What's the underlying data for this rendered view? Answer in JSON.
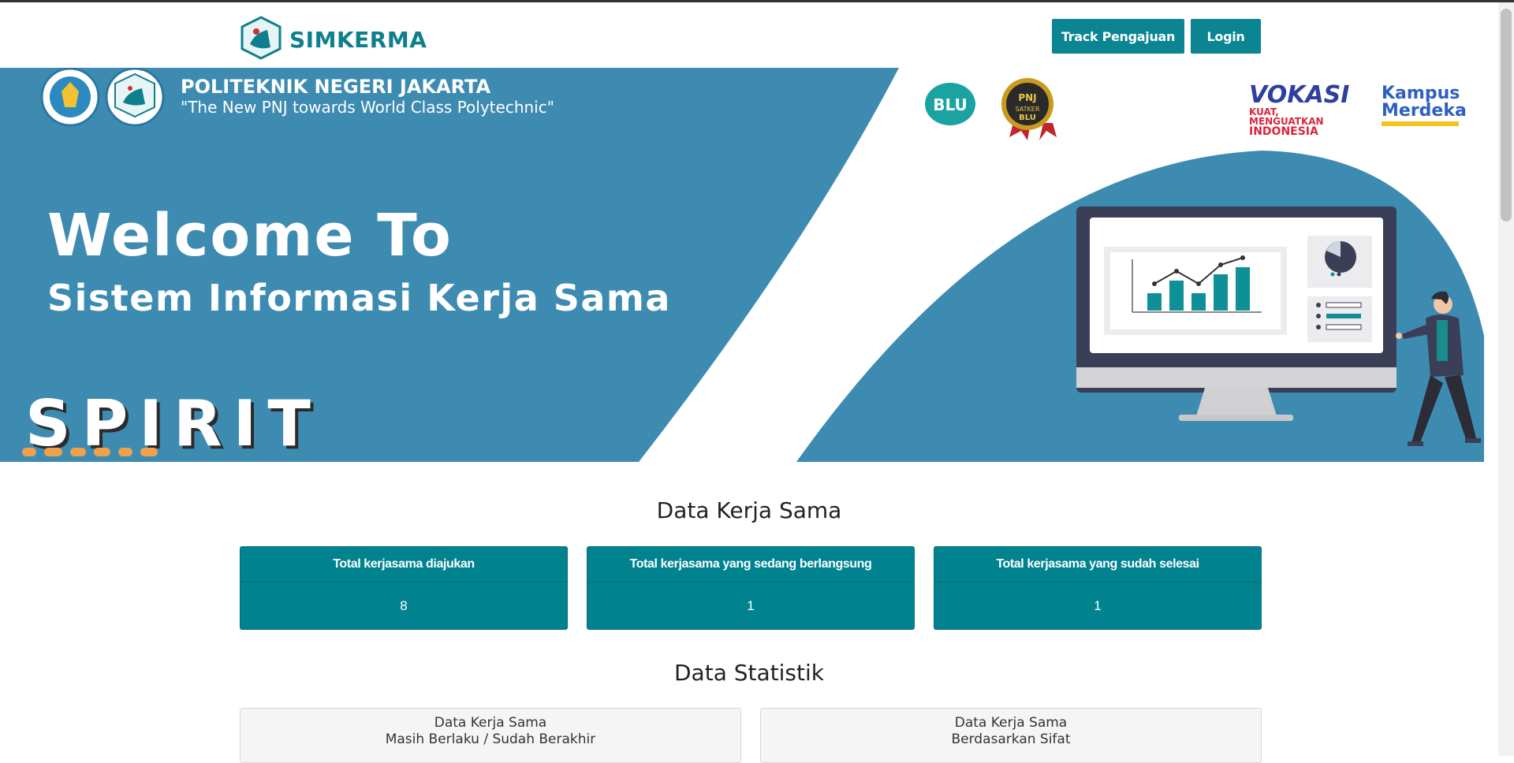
{
  "navbar": {
    "brand": "SIMKERMA",
    "track_label": "Track Pengajuan",
    "login_label": "Login"
  },
  "hero": {
    "institution": "POLITEKNIK NEGERI JAKARTA",
    "tagline": "\"The New  PNJ towards World Class Polytechnic\"",
    "welcome_line1": "Welcome To",
    "welcome_line2": "Sistem Informasi Kerja Sama",
    "spirit": "SPIRIT",
    "blu_badge": "BLU",
    "pnj_badge": "PNJ SATKER BLU",
    "vokasi_logo": "VOKASI KUAT, MENGUATKAN INDONESIA",
    "merdeka_logo": "Kampus Merdeka",
    "colors": {
      "primary_blue": "#3e8bb2",
      "teal": "#0a8591"
    }
  },
  "data_kerja_sama": {
    "title": "Data Kerja Sama",
    "cards": [
      {
        "label": "Total kerjasama diajukan",
        "value": "8"
      },
      {
        "label": "Total kerjasama yang sedang berlangsung",
        "value": "1"
      },
      {
        "label": "Total kerjasama yang sudah selesai",
        "value": "1"
      }
    ]
  },
  "data_statistik": {
    "title": "Data Statistik",
    "boxes": [
      {
        "line1": "Data Kerja Sama",
        "line2": "Masih Berlaku / Sudah Berakhir"
      },
      {
        "line1": "Data Kerja Sama",
        "line2": "Berdasarkan Sifat"
      }
    ]
  }
}
